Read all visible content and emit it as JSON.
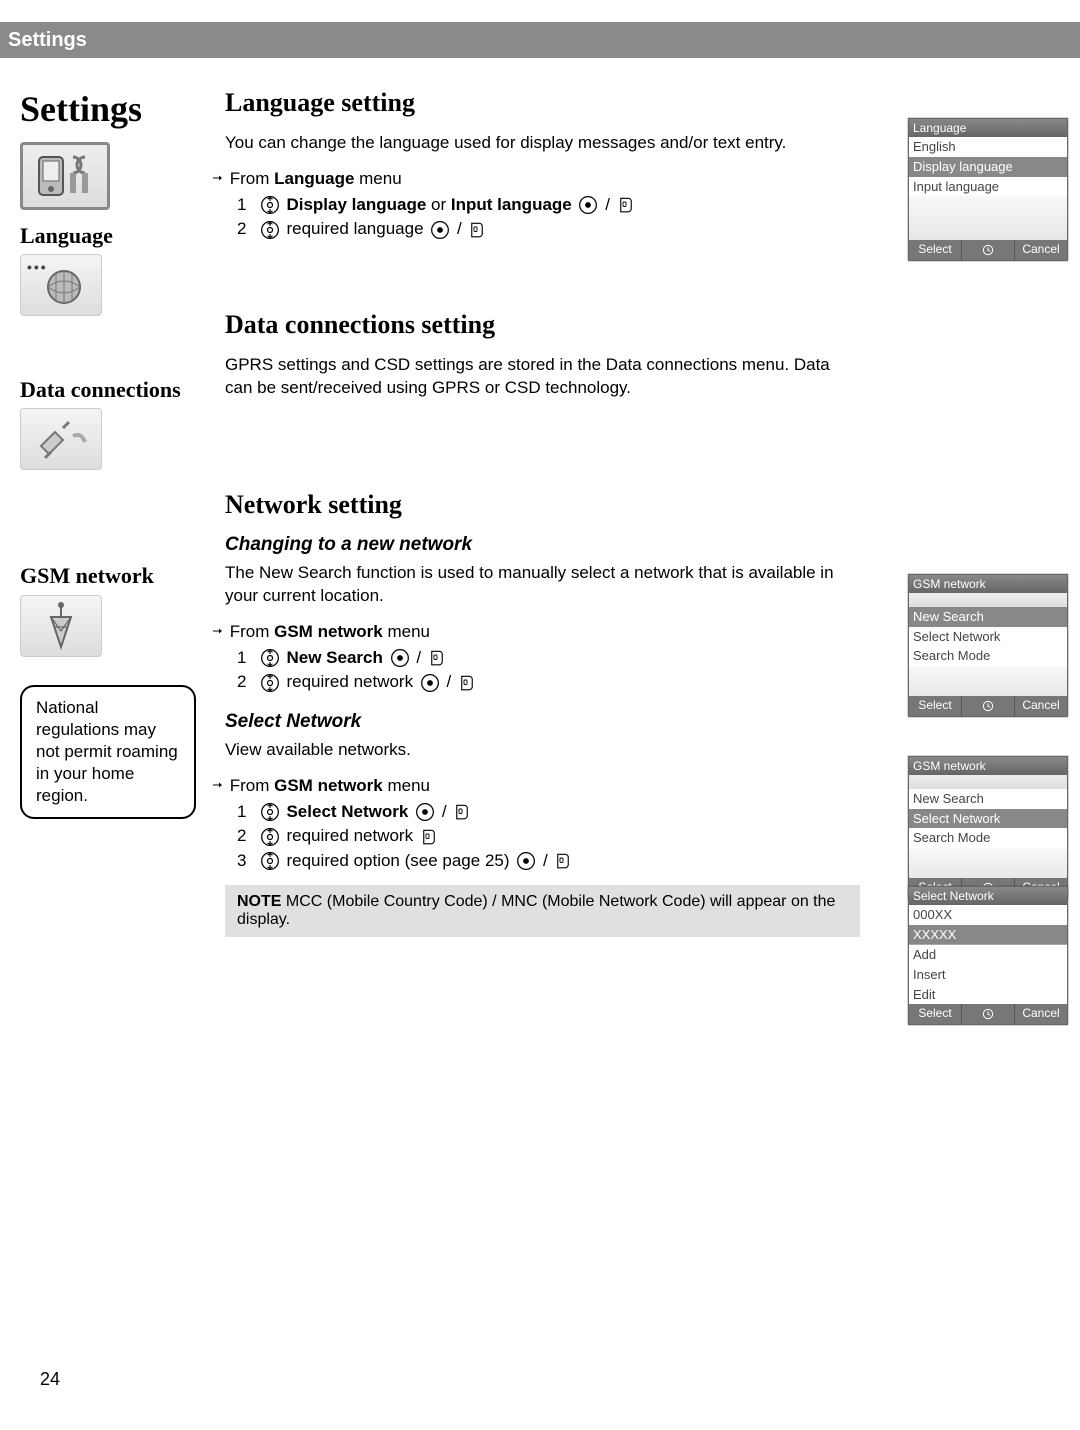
{
  "header": {
    "title": "Settings"
  },
  "sidebar": {
    "settings_title": "Settings",
    "language_title": "Language",
    "data_connections_title": "Data connections",
    "gsm_network_title": "GSM network",
    "roaming_note": "National regulations may not permit roaming in your home region."
  },
  "sections": {
    "language": {
      "heading": "Language setting",
      "desc": "You can change the language used for display messages and/or text entry.",
      "from_prefix": "From ",
      "from_bold": "Language",
      "from_suffix": " menu",
      "steps": [
        {
          "n": "1",
          "bold1": "Display language",
          "mid": " or ",
          "bold2": "Input language"
        },
        {
          "n": "2",
          "plain": "required language"
        }
      ],
      "phone": {
        "title": "Language",
        "row1": "English",
        "row_hl": "Display language",
        "row2": "Input language",
        "footer": [
          "Select",
          "",
          "Cancel"
        ]
      }
    },
    "data": {
      "heading": "Data connections setting",
      "desc": "GPRS settings and CSD settings are stored in the Data connections menu. Data can be sent/received using GPRS or CSD technology."
    },
    "network": {
      "heading": "Network setting",
      "sub1": "Changing to a new network",
      "desc1": "The New Search function is used to manually select a network that is available in your current location.",
      "from1_prefix": "From ",
      "from1_bold": "GSM network",
      "from1_suffix": " menu",
      "steps1": [
        {
          "n": "1",
          "bold": "New Search"
        },
        {
          "n": "2",
          "plain": "required network"
        }
      ],
      "sub2": "Select Network",
      "desc2": "View available networks.",
      "from2_prefix": "From ",
      "from2_bold": "GSM network",
      "from2_suffix": " menu",
      "steps2": [
        {
          "n": "1",
          "bold": "Select Network"
        },
        {
          "n": "2",
          "plain": "required network"
        },
        {
          "n": "3",
          "plain": "required option (see page 25)"
        }
      ],
      "note_label": "NOTE",
      "note_text": "  MCC (Mobile Country Code) / MNC (Mobile Network Code) will appear on the display.",
      "phone1": {
        "title": "GSM network",
        "row_hl": "New Search",
        "row1": "Select Network",
        "row2": "Search Mode",
        "footer": [
          "Select",
          "",
          "Cancel"
        ]
      },
      "phone2": {
        "title": "GSM network",
        "row1": "New Search",
        "row_hl": "Select Network",
        "row2": "Search Mode",
        "footer": [
          "Select",
          "",
          "Cancel"
        ]
      },
      "phone3": {
        "title": "Select Network",
        "row1": "000XX",
        "row_hl": "XXXXX",
        "row2": "Add",
        "row3": "Insert",
        "row4": "Edit",
        "footer": [
          "Select",
          "",
          "Cancel"
        ]
      }
    }
  },
  "page_number": "24"
}
